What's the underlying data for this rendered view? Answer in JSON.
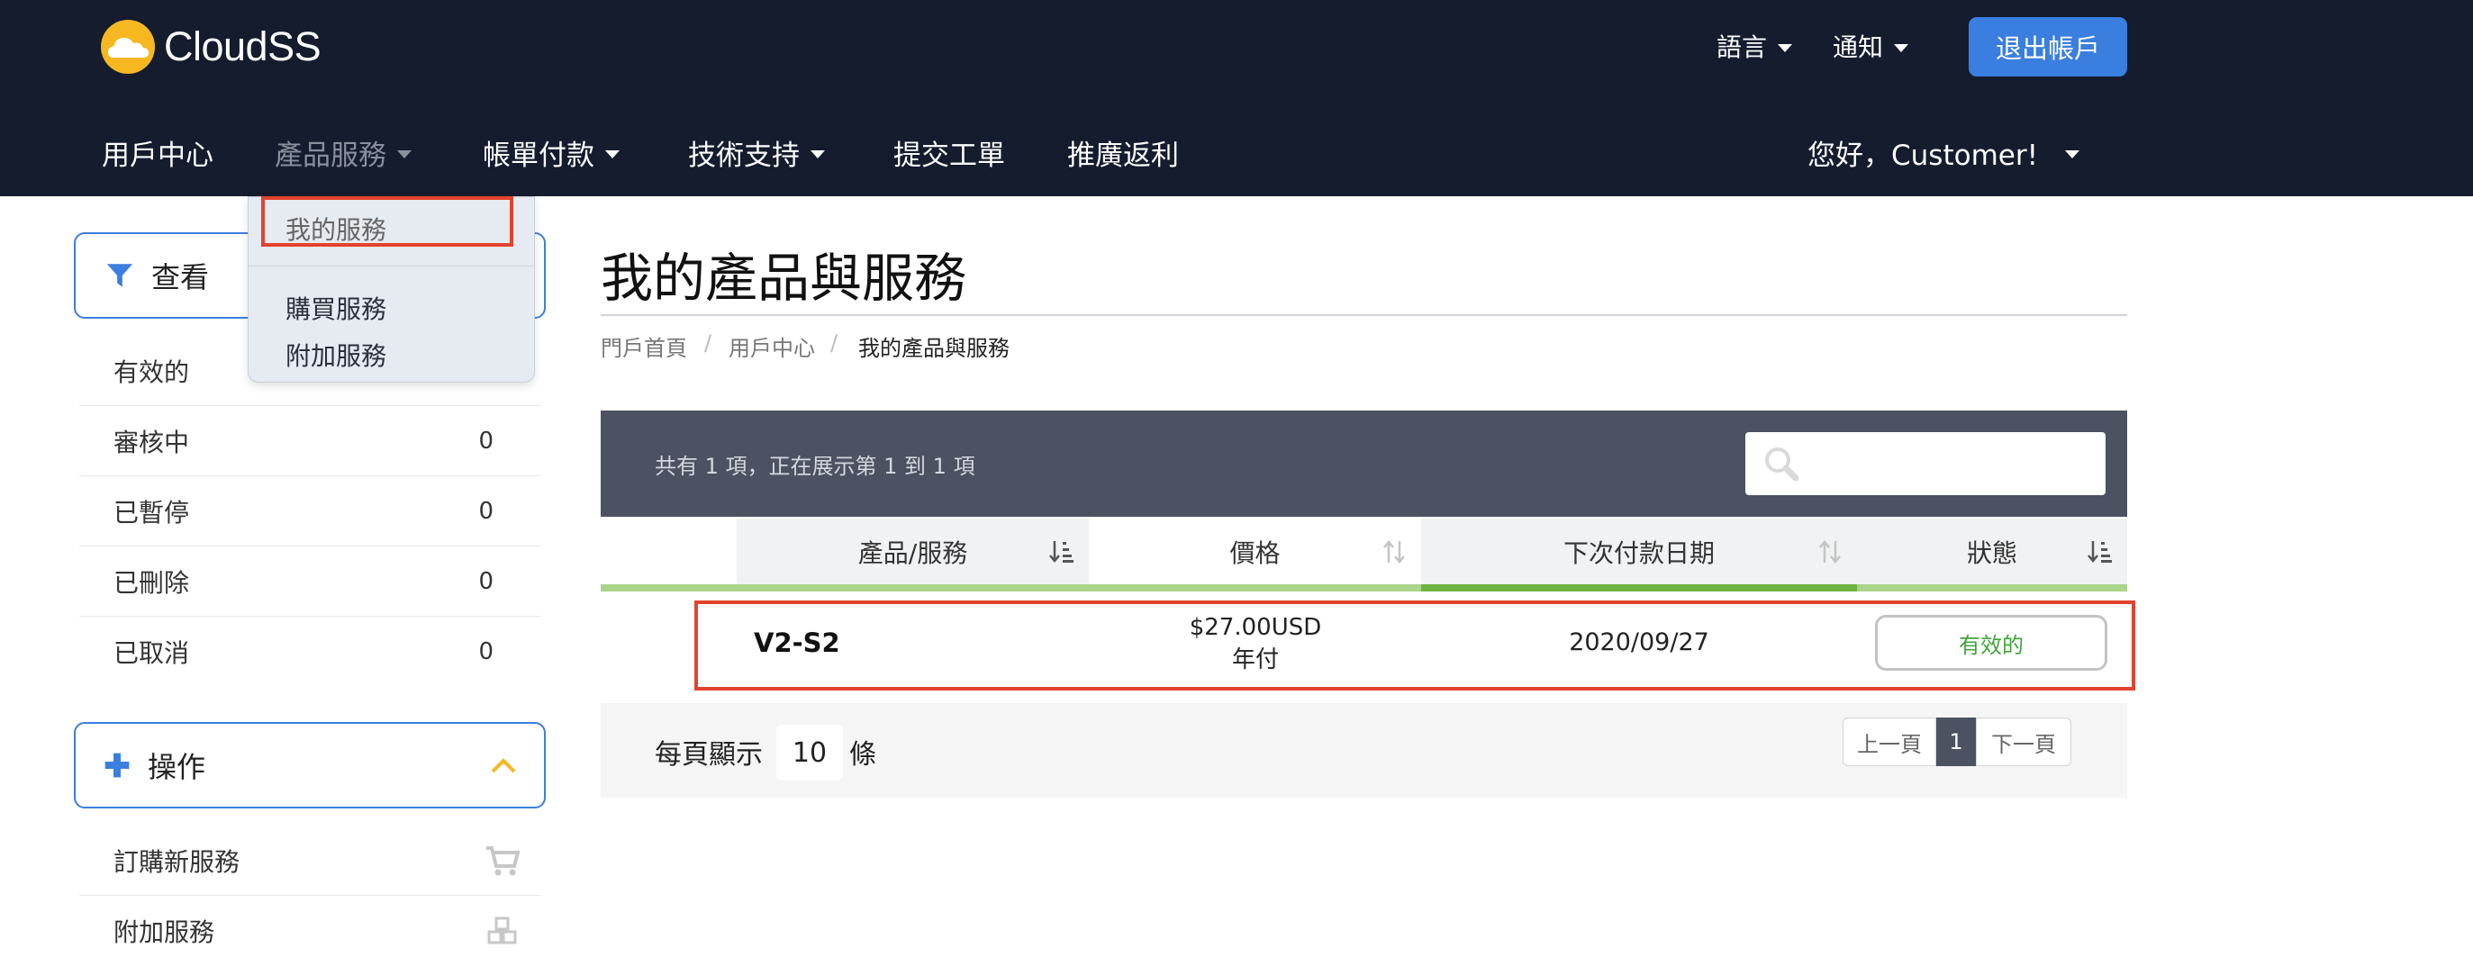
{
  "header": {
    "logo_text": "CloudSS",
    "top_links": [
      {
        "label": "語言"
      },
      {
        "label": "通知"
      }
    ],
    "logout_label": "退出帳戶",
    "main_nav": [
      {
        "label": "用戶中心"
      },
      {
        "label": "產品服務"
      },
      {
        "label": "帳單付款"
      },
      {
        "label": "技術支持"
      },
      {
        "label": "提交工單"
      },
      {
        "label": "推廣返利"
      }
    ],
    "greeting": "您好，Customer!"
  },
  "dropdown": {
    "items": [
      {
        "label": "我的服務"
      },
      {
        "label": "購買服務"
      },
      {
        "label": "附加服務"
      }
    ]
  },
  "sidebar": {
    "filter_title": "查看",
    "filter_items": [
      {
        "label": "有效的",
        "count": ""
      },
      {
        "label": "審核中",
        "count": "0"
      },
      {
        "label": "已暫停",
        "count": "0"
      },
      {
        "label": "已刪除",
        "count": "0"
      },
      {
        "label": "已取消",
        "count": "0"
      }
    ],
    "actions_title": "操作",
    "action_items": [
      {
        "label": "訂購新服務",
        "icon": "cart-icon"
      },
      {
        "label": "附加服務",
        "icon": "cubes-icon"
      }
    ]
  },
  "main": {
    "title": "我的產品與服務",
    "breadcrumb": [
      "門戶首頁",
      "用戶中心",
      "我的產品與服務"
    ],
    "table": {
      "summary": "共有 1 項，正在展示第 1 到 1 項",
      "search_placeholder": "",
      "columns": [
        "產品/服務",
        "價格",
        "下次付款日期",
        "狀態"
      ],
      "rows": [
        {
          "product": "V2-S2",
          "price": "$27.00USD",
          "cycle": "年付",
          "next_due": "2020/09/27",
          "status": "有效的"
        }
      ]
    },
    "pagination": {
      "per_page_label": "每頁顯示",
      "per_page_value": "10",
      "per_page_unit": "條",
      "prev": "上一頁",
      "current": "1",
      "next": "下一頁"
    }
  },
  "colors": {
    "header_bg": "#141c2e",
    "accent": "#3a7ee0",
    "highlight": "#e2432c",
    "status_green": "#3fa43a",
    "column_bar_green": "#6db33f"
  }
}
